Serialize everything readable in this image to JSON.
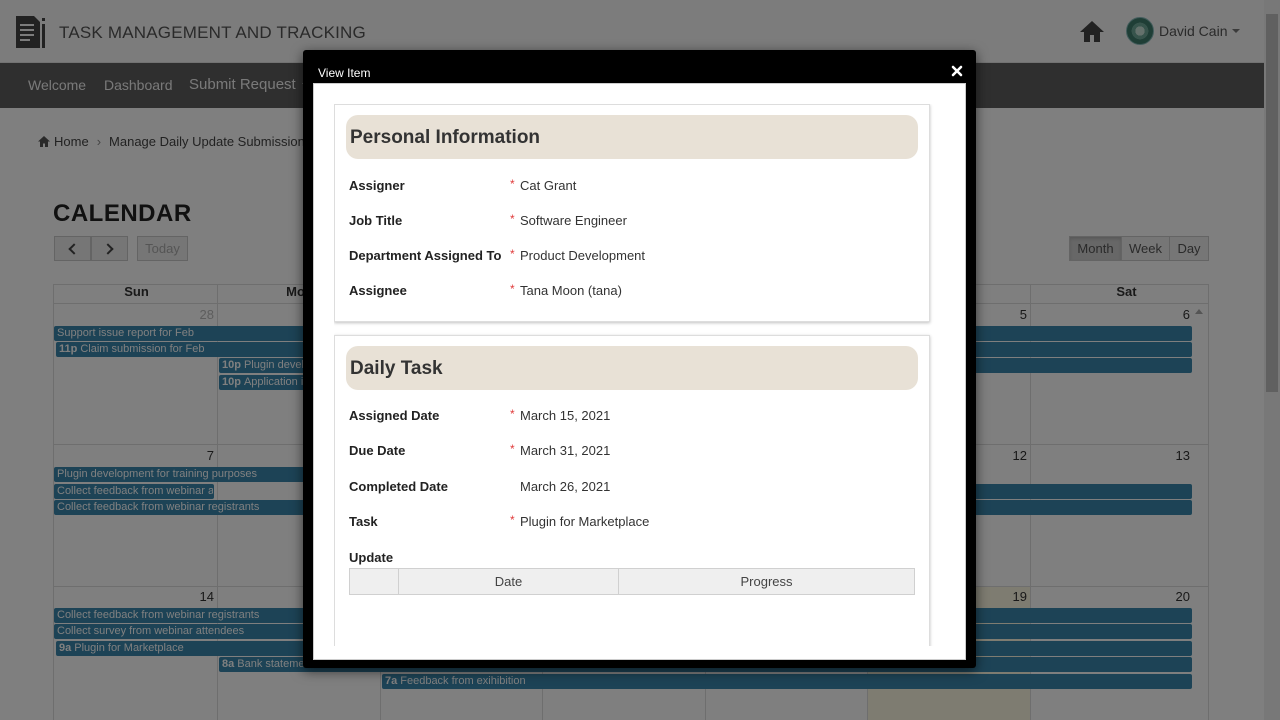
{
  "app": {
    "title": "TASK MANAGEMENT AND TRACKING",
    "user_name": "David Cain"
  },
  "nav": {
    "items": [
      "Welcome",
      "Dashboard",
      "Submit Request"
    ]
  },
  "breadcrumb": {
    "home": "Home",
    "current": "Manage Daily Update Submissions"
  },
  "calendar": {
    "title": "CALENDAR",
    "today_label": "Today",
    "views": [
      "Month",
      "Week",
      "Day"
    ],
    "active_view": "Month",
    "day_headers": [
      "Sun",
      "Mon",
      "",
      "",
      "",
      "",
      "Sat"
    ],
    "day_numbers": {
      "w1_sun": "28",
      "w1_fri": "5",
      "w1_sat": "6",
      "w2_sun": "7",
      "w2_fri": "12",
      "w2_sat": "13",
      "w3_sun": "14",
      "w3_fri": "19",
      "w3_sat": "20"
    },
    "events": [
      {
        "time": "",
        "text": "Support issue report for Feb"
      },
      {
        "time": "11p",
        "text": "Claim submission for Feb"
      },
      {
        "time": "10p",
        "text": "Plugin development for training purposes"
      },
      {
        "time": "10p",
        "text": "Application improvement"
      },
      {
        "time": "",
        "text": "Plugin development for training purposes"
      },
      {
        "time": "",
        "text": "Collect feedback from webinar attendees"
      },
      {
        "time": "",
        "text": "Collect feedback from webinar registrants"
      },
      {
        "time": "",
        "text": "Collect feedback from webinar registrants"
      },
      {
        "time": "",
        "text": "Collect survey from webinar attendees"
      },
      {
        "time": "9a",
        "text": "Plugin for Marketplace"
      },
      {
        "time": "8a",
        "text": "Bank statement for Feb"
      },
      {
        "time": "7a",
        "text": "Feedback from exihibition"
      }
    ]
  },
  "modal": {
    "title": "View Item",
    "personal": {
      "heading": "Personal Information",
      "fields": [
        {
          "label": "Assigner",
          "value": "Cat Grant",
          "required": "*"
        },
        {
          "label": "Job Title",
          "value": "Software Engineer",
          "required": "*"
        },
        {
          "label": "Department Assigned To",
          "value": "Product Development",
          "required": "*"
        },
        {
          "label": "Assignee",
          "value": "Tana Moon (tana)",
          "required": "*"
        }
      ]
    },
    "daily": {
      "heading": "Daily Task",
      "fields": [
        {
          "label": "Assigned Date",
          "value": "March 15, 2021",
          "required": "*"
        },
        {
          "label": "Due Date",
          "value": "March 31, 2021",
          "required": "*"
        },
        {
          "label": "Completed Date",
          "value": "March 26, 2021",
          "required": ""
        },
        {
          "label": "Task",
          "value": "Plugin for Marketplace",
          "required": "*"
        }
      ],
      "update_label": "Update",
      "table_headers": [
        "",
        "Date",
        "Progress"
      ]
    }
  },
  "colors": {
    "event": "#3a87ad",
    "section_header": "#e8e1d6",
    "required": "#e03b3b",
    "nav": "#5f5f5f"
  }
}
